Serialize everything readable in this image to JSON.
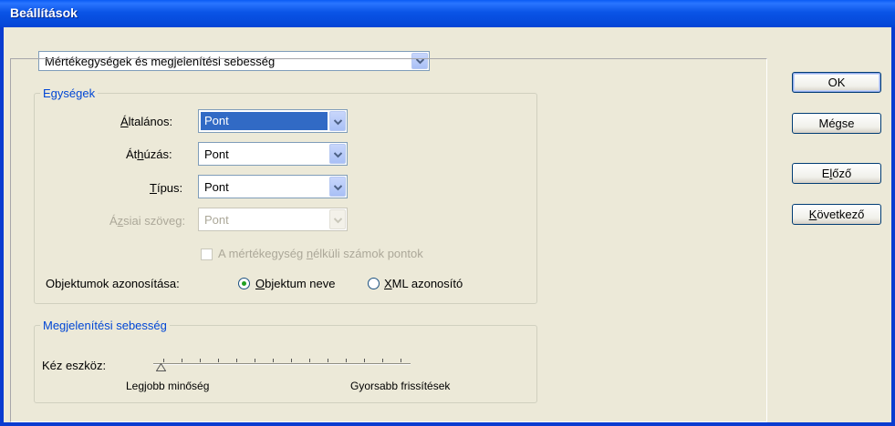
{
  "window": {
    "title": "Beállítások"
  },
  "category": {
    "value": "Mértékegységek és megjelenítési sebesség"
  },
  "units": {
    "legend": "Egységek",
    "general": {
      "label_pre": "",
      "label_u": "Á",
      "label_post": "ltalános:",
      "value": "Pont"
    },
    "strikethrough": {
      "label_pre": "Át",
      "label_u": "h",
      "label_post": "úzás:",
      "value": "Pont"
    },
    "type": {
      "label_pre": "",
      "label_u": "T",
      "label_post": "ípus:",
      "value": "Pont"
    },
    "asian": {
      "label_pre": "Á",
      "label_u": "z",
      "label_post": "siai szöveg:",
      "value": "Pont"
    },
    "unitless_checkbox": {
      "label_pre": "A mértékegység ",
      "label_u": "n",
      "label_post": "élküli számok pontok",
      "checked": false
    },
    "object_id": {
      "label": "Objektumok azonosítása:",
      "option_name": {
        "label_u": "O",
        "label_post": "bjektum neve",
        "selected": true
      },
      "option_xml": {
        "label_u": "X",
        "label_post": "ML azonosító",
        "selected": false
      }
    }
  },
  "display": {
    "legend": "Megjelenítési sebesség",
    "hand_tool_label": "Kéz eszköz:",
    "slider_min_label": "Legjobb minőség",
    "slider_max_label": "Gyorsabb frissítések",
    "slider_position": 0
  },
  "buttons": {
    "ok": "OK",
    "cancel": "Mégse",
    "prev": {
      "pre": "E",
      "u": "l",
      "post": "őző"
    },
    "next": {
      "pre": "",
      "u": "K",
      "post": "övetkező"
    }
  }
}
